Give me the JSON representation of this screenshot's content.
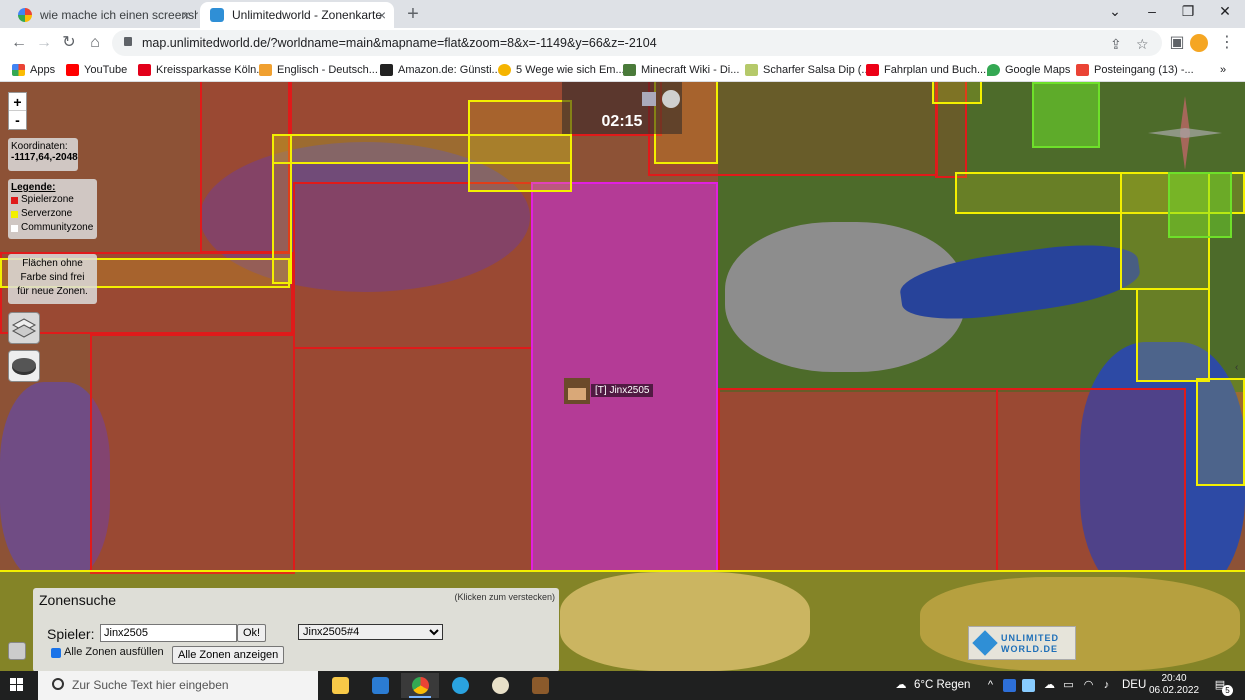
{
  "browser": {
    "tabs": [
      {
        "title": "wie mache ich einen screenshot a",
        "active": false,
        "icon": "google-icon"
      },
      {
        "title": "Unlimitedworld - Zonenkarte",
        "active": true,
        "icon": "unlimitedworld-icon"
      }
    ],
    "url": "map.unlimitedworld.de/?worldname=main&mapname=flat&zoom=8&x=-1149&y=66&z=-2104",
    "bookmarks": [
      {
        "label": "Apps",
        "icon": "apps-grid-icon",
        "color": "#ea4335"
      },
      {
        "label": "YouTube",
        "icon": "youtube-icon",
        "color": "#ff0000"
      },
      {
        "label": "Kreissparkasse Köln...",
        "icon": "sparkasse-icon",
        "color": "#e2001a"
      },
      {
        "label": "Englisch - Deutsch...",
        "icon": "dictionary-icon",
        "color": "#f0a030"
      },
      {
        "label": "Amazon.de: Günsti...",
        "icon": "amazon-icon",
        "color": "#222222"
      },
      {
        "label": "5 Wege wie sich Em...",
        "icon": "article-icon",
        "color": "#f5b400"
      },
      {
        "label": "Minecraft Wiki - Di...",
        "icon": "minecraft-wiki-icon",
        "color": "#4a7a3a"
      },
      {
        "label": "Scharfer Salsa Dip (...",
        "icon": "recipe-icon",
        "color": "#b5c96a"
      },
      {
        "label": "Fahrplan und Buch...",
        "icon": "db-icon",
        "color": "#ec0016"
      },
      {
        "label": "Google Maps",
        "icon": "maps-pin-icon",
        "color": "#34a853"
      },
      {
        "label": "Posteingang (13) -...",
        "icon": "gmail-icon",
        "color": "#ea4335"
      }
    ]
  },
  "map": {
    "zoom_in": "+",
    "zoom_out": "-",
    "coords_title": "Koordinaten:",
    "coords_value": "-1117,64,-2048",
    "legend_title": "Legende:",
    "legend": [
      {
        "label": "Spielerzone",
        "color": "#e01a1a"
      },
      {
        "label": "Serverzone",
        "color": "#f3f000"
      },
      {
        "label": "Communityzone",
        "color": "#ffffff"
      }
    ],
    "free_note": [
      "Flächen ohne",
      "Farbe sind frei",
      "für neue Zonen."
    ],
    "time": "02:15",
    "player_label": "[T] Jinx2505",
    "logo_text": [
      "UNLIMITED",
      "WORLD.DE"
    ]
  },
  "zonesearch": {
    "title": "Zonensuche",
    "hide_hint": "(Klicken zum verstecken)",
    "player_label": "Spieler:",
    "player_value": "Jinx2505",
    "ok_label": "Ok!",
    "select_value": "Jinx2505#4",
    "fill_all_label": "Alle Zonen ausfüllen",
    "show_all_label": "Alle Zonen anzeigen"
  },
  "taskbar": {
    "search_placeholder": "Zur Suche Text hier eingeben",
    "weather": "6°C  Regen",
    "language": "DEU",
    "time": "20:40",
    "date": "06.02.2022",
    "notification_count": "5"
  }
}
